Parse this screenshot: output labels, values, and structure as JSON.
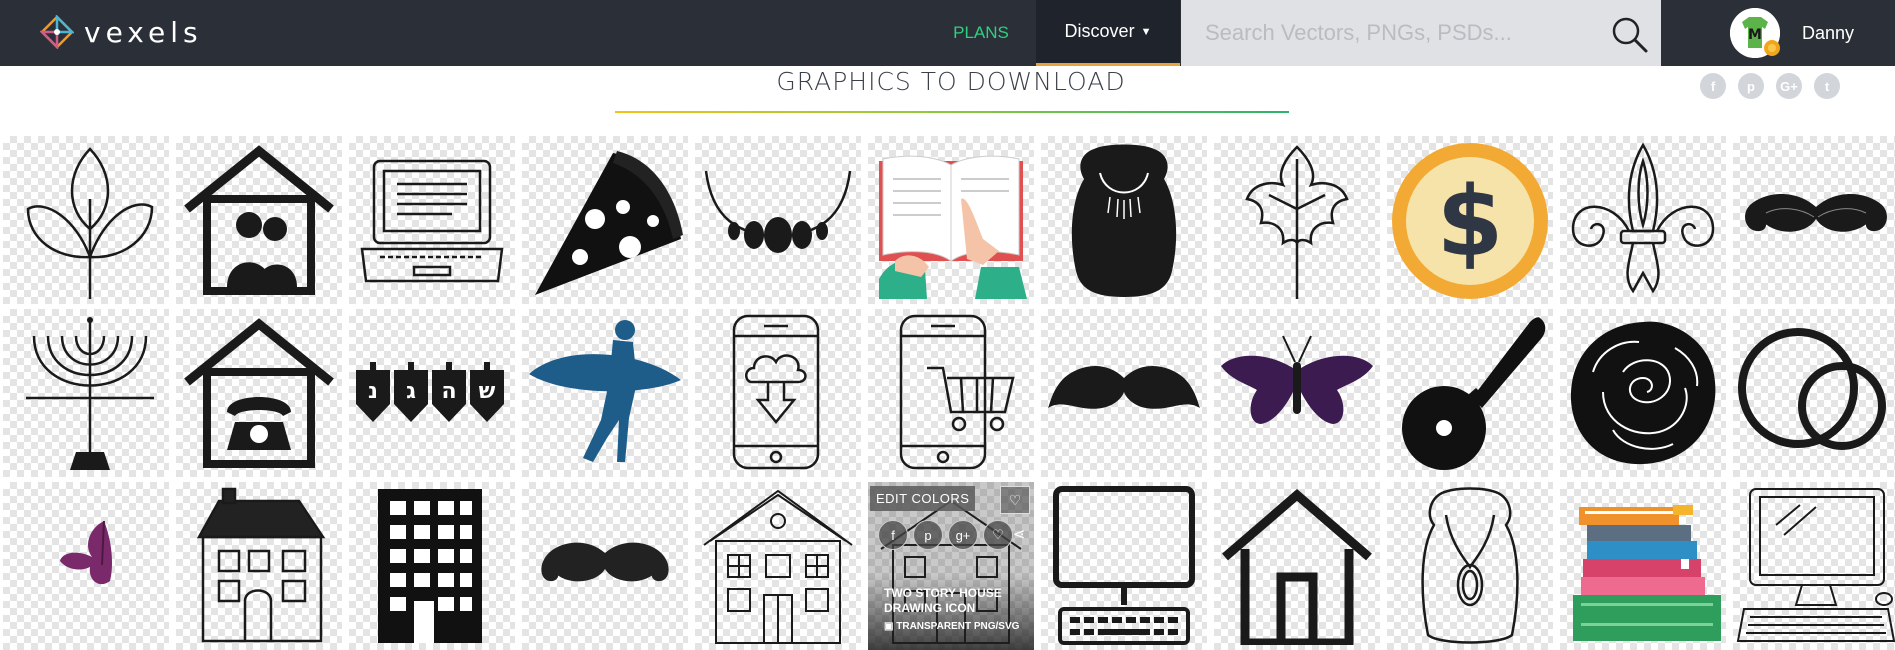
{
  "brand": {
    "name": "vexels"
  },
  "nav": {
    "plans_label": "PLANS",
    "discover_label": "Discover"
  },
  "search": {
    "placeholder": "Search Vectors, PNGs, PSDs..."
  },
  "user": {
    "name": "Danny"
  },
  "page": {
    "heading": "GRAPHICS TO DOWNLOAD"
  },
  "social": [
    {
      "icon": "facebook-icon",
      "glyph": "f"
    },
    {
      "icon": "pinterest-icon",
      "glyph": "p"
    },
    {
      "icon": "google-plus-icon",
      "glyph": "G+"
    },
    {
      "icon": "twitter-icon",
      "glyph": "t"
    }
  ],
  "hover_card": {
    "edit_label": "EDIT COLORS",
    "title": "TWO STORY HOUSE DRAWING ICON",
    "subtitle": "TRANSPARENT PNG/SVG",
    "share_icons": [
      "facebook-icon",
      "pinterest-icon",
      "google-plus-icon",
      "heart-icon"
    ]
  },
  "colors": {
    "topbar": "#2b2f38",
    "accent_green": "#2ed180",
    "discover_bg": "#1f232b",
    "search_bg": "#dfe1e4"
  },
  "graphics": [
    [
      "leaf-plant-icon",
      "house-family-icon",
      "laptop-icon",
      "pizza-slice-icon",
      "necklace-icon",
      "book-reading-icon",
      "necklace-bust-icon",
      "leaf-outline-icon",
      "dollar-coin-icon",
      "fleur-de-lis-icon",
      "mustache-icon"
    ],
    [
      "menorah-icon",
      "house-phone-icon",
      "dreidels-icon",
      "surfer-icon",
      "phone-cloud-download-icon",
      "phone-shopping-cart-icon",
      "mustache-icon",
      "butterfly-icon",
      "pizza-cutter-icon",
      "rose-icon",
      "wedding-rings-icon"
    ],
    [
      "small-butterfly-icon",
      "sketch-house-icon",
      "office-building-icon",
      "mustache-icon",
      "two-story-house-icon",
      "two-story-house-drawing-icon",
      "desktop-computer-icon",
      "house-outline-icon",
      "necklace-outline-icon",
      "books-stack-icon",
      "desktop-sketch-icon"
    ]
  ]
}
